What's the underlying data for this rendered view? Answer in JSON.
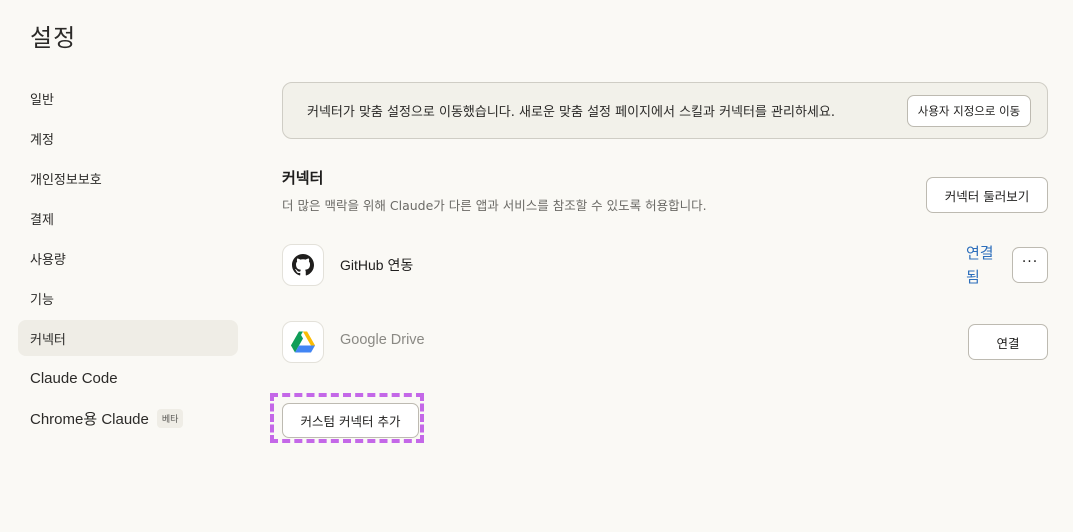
{
  "page": {
    "title": "설정"
  },
  "sidebar": {
    "items": [
      {
        "label": "일반",
        "active": false
      },
      {
        "label": "계정",
        "active": false
      },
      {
        "label": "개인정보보호",
        "active": false
      },
      {
        "label": "결제",
        "active": false
      },
      {
        "label": "사용량",
        "active": false
      },
      {
        "label": "기능",
        "active": false
      },
      {
        "label": "커넥터",
        "active": true
      },
      {
        "label": "Claude Code",
        "active": false
      },
      {
        "label": "Chrome용 Claude",
        "active": false,
        "badge": "베타"
      }
    ]
  },
  "notice": {
    "text": "커넥터가 맞춤 설정으로 이동했습니다. 새로운 맞춤 설정 페이지에서 스킬과 커넥터를 관리하세요.",
    "button_label": "사용자 지정으로 이동"
  },
  "connectors": {
    "title": "커넥터",
    "description": "더 많은 맥락을 위해 Claude가 다른 앱과 서비스를 참조할 수 있도록 허용합니다.",
    "browse_label": "커넥터 둘러보기",
    "items": [
      {
        "name": "GitHub 연동",
        "icon": "github-icon",
        "status": "연결됨",
        "more_label": "···"
      },
      {
        "name": "Google Drive",
        "icon": "google-drive-icon",
        "button_label": "연결"
      }
    ],
    "add_custom_label": "커스텀 커넥터 추가"
  },
  "colors": {
    "background": "#faf9f5",
    "active_nav": "#efede6",
    "link": "#2d6fbc",
    "highlight_dash": "#c468e8"
  }
}
